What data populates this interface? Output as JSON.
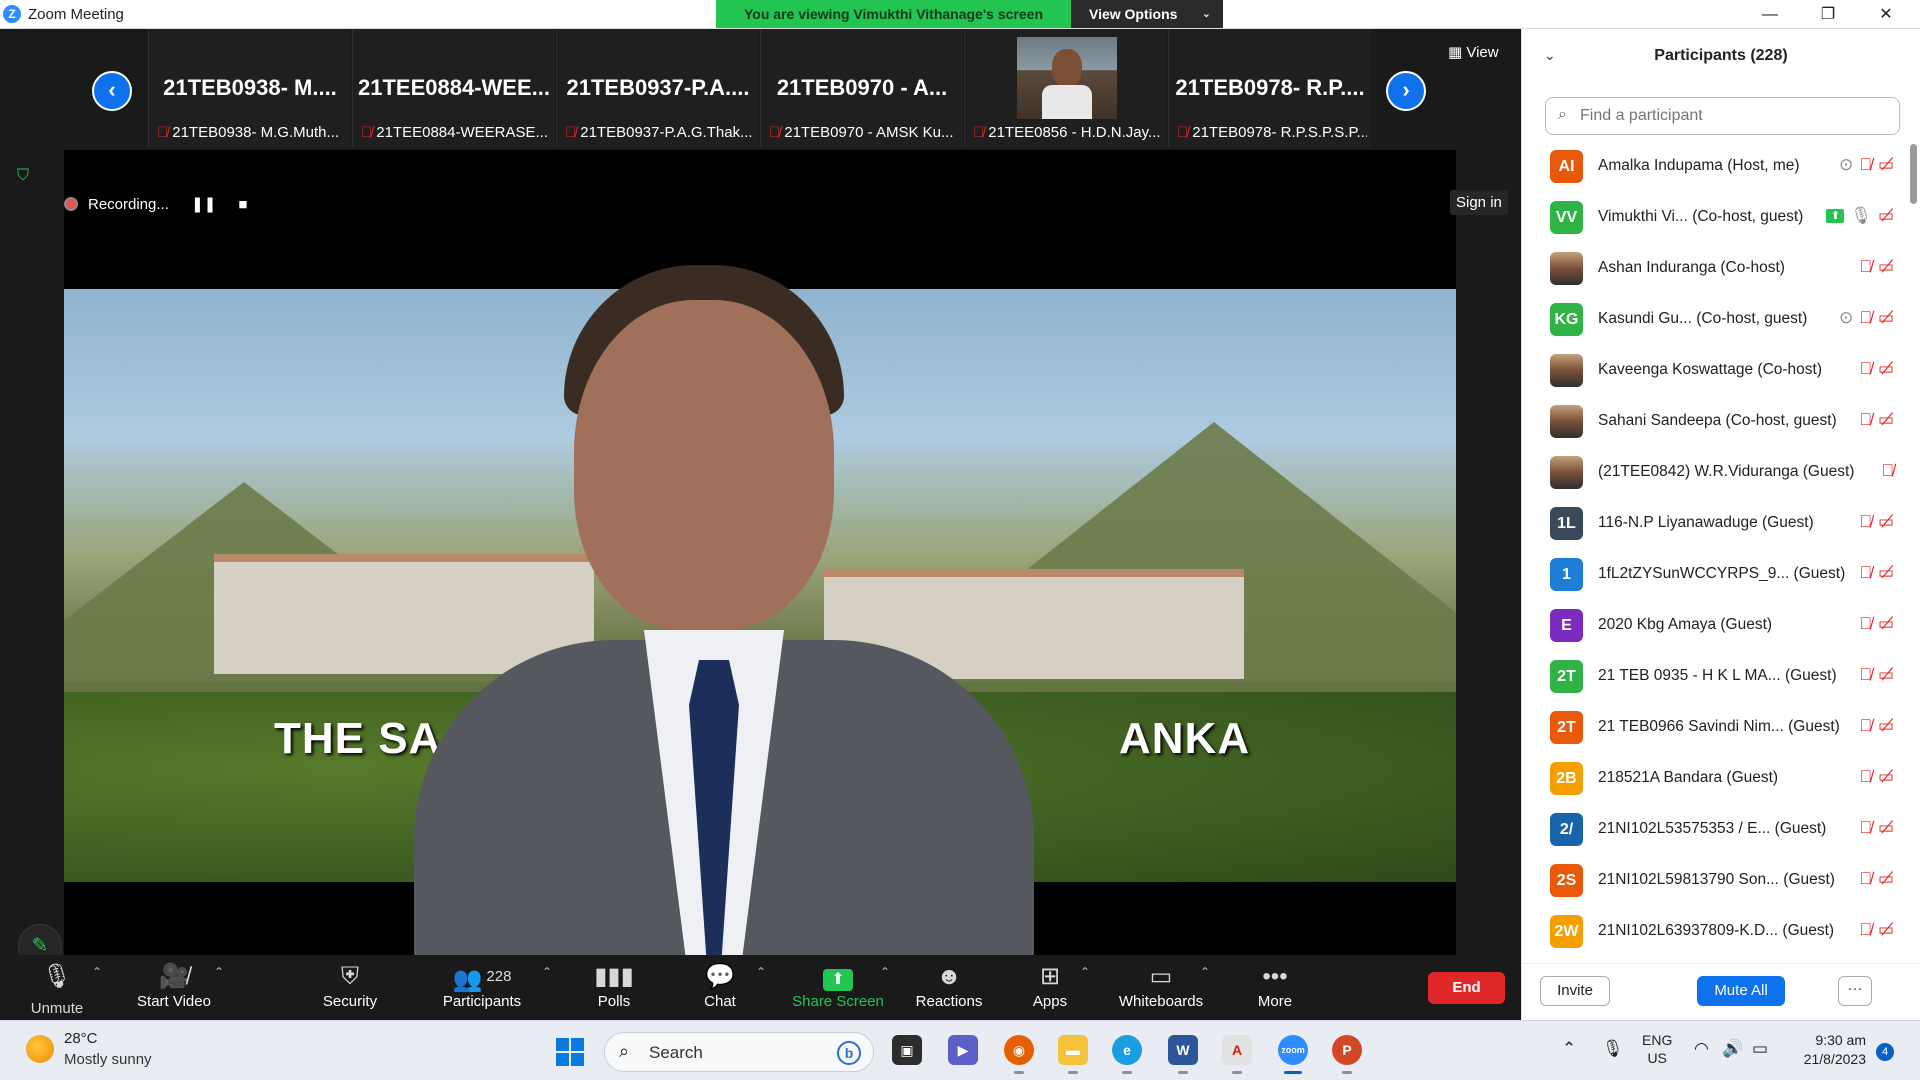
{
  "window": {
    "title": "Zoom Meeting",
    "logo_letter": "Z",
    "controls": [
      "—",
      "❐",
      "✕"
    ]
  },
  "share_banner": {
    "text": "You are viewing Vimukthi Vithanage's screen",
    "view_options": "View Options"
  },
  "thumbnails": [
    {
      "big": "21TEB0938- M....",
      "small": "21TEB0938- M.G.Muth..."
    },
    {
      "big": "21TEE0884-WEE...",
      "small": "21TEE0884-WEERASE..."
    },
    {
      "big": "21TEB0937-P.A....",
      "small": "21TEB0937-P.A.G.Thak..."
    },
    {
      "big": "21TEB0970 - A...",
      "small": "21TEB0970 - AMSK Ku..."
    },
    {
      "big": "",
      "small": "21TEE0856 - H.D.N.Jay..."
    },
    {
      "big": "21TEB0978- R.P....",
      "small": "21TEB0978- R.P.S.P.S.P..."
    }
  ],
  "meeting": {
    "view_label": "View",
    "recording_label": "Recording...",
    "sign_in": "Sign in",
    "overlay_left": "THE SA",
    "overlay_right": "ANKA"
  },
  "toolbar": {
    "unmute": "Unmute",
    "start_video": "Start Video",
    "security": "Security",
    "participants": "Participants",
    "participants_count": "228",
    "polls": "Polls",
    "chat": "Chat",
    "share_screen": "Share Screen",
    "reactions": "Reactions",
    "apps": "Apps",
    "whiteboards": "Whiteboards",
    "more": "More",
    "end": "End"
  },
  "panel": {
    "title": "Participants (228)",
    "search_placeholder": "Find a participant",
    "participants": [
      {
        "initials": "AI",
        "color": "#e8590c",
        "name": "Amalka Indupama (Host, me)",
        "photo": false
      },
      {
        "initials": "VV",
        "color": "#2fb344",
        "name": "Vimukthi Vi...  (Co-host, guest)",
        "photo": false
      },
      {
        "initials": "",
        "color": "#000000",
        "name": "Ashan Induranga (Co-host)",
        "photo": true
      },
      {
        "initials": "KG",
        "color": "#2fb344",
        "name": "Kasundi Gu...  (Co-host, guest)",
        "photo": false
      },
      {
        "initials": "",
        "color": "#000000",
        "name": "Kaveenga Koswattage (Co-host)",
        "photo": true
      },
      {
        "initials": "",
        "color": "#000000",
        "name": "Sahani Sandeepa (Co-host, guest)",
        "photo": true
      },
      {
        "initials": "",
        "color": "#000000",
        "name": "(21TEE0842) W.R.Viduranga (Guest)",
        "photo": true
      },
      {
        "initials": "1L",
        "color": "#3b4a5a",
        "name": "116-N.P Liyanawaduge (Guest)",
        "photo": false
      },
      {
        "initials": "1",
        "color": "#1c7ed6",
        "name": "1fL2tZYSunWCCYRPS_9...  (Guest)",
        "photo": false
      },
      {
        "initials": "E",
        "color": "#7b2cbf",
        "name": "2020 Kbg Amaya (Guest)",
        "photo": false
      },
      {
        "initials": "2T",
        "color": "#2fb344",
        "name": "21 TEB 0935 - H K L MA...  (Guest)",
        "photo": false
      },
      {
        "initials": "2T",
        "color": "#e8590c",
        "name": "21 TEB0966 Savindi Nim...  (Guest)",
        "photo": false
      },
      {
        "initials": "2B",
        "color": "#f59f00",
        "name": "218521A Bandara (Guest)",
        "photo": false
      },
      {
        "initials": "2/",
        "color": "#1864ab",
        "name": "21NI102L53575353 / E...  (Guest)",
        "photo": false
      },
      {
        "initials": "2S",
        "color": "#e8590c",
        "name": "21NI102L59813790 Son...  (Guest)",
        "photo": false
      },
      {
        "initials": "2W",
        "color": "#f59f00",
        "name": "21NI102L63937809-K.D...  (Guest)",
        "photo": false
      }
    ],
    "invite": "Invite",
    "mute_all": "Mute All",
    "more": "···"
  },
  "taskbar": {
    "temp": "28°C",
    "weather": "Mostly sunny",
    "search": "Search",
    "lang_top": "ENG",
    "lang_bottom": "US",
    "time": "9:30 am",
    "date": "21/8/2023",
    "notif_count": "4"
  }
}
